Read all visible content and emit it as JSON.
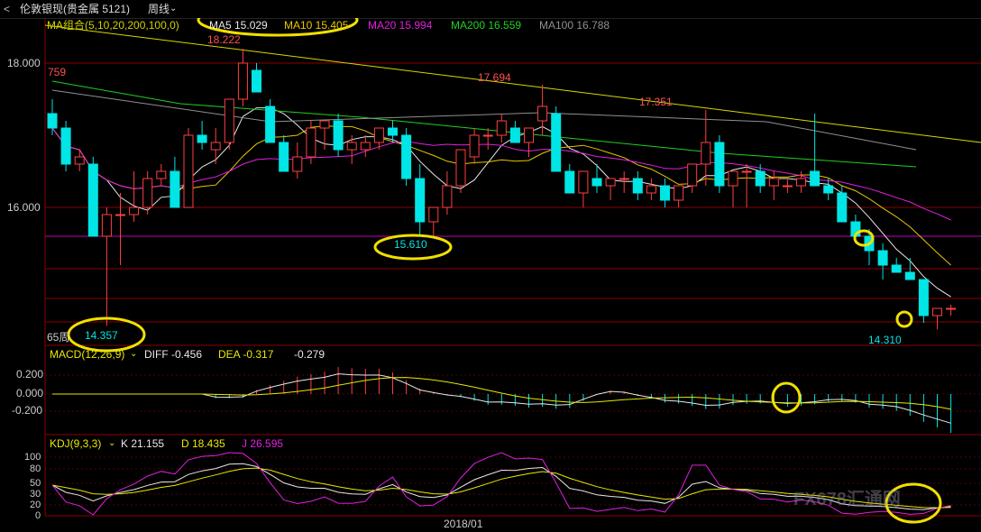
{
  "window": {
    "title": "伦敦银现(贵金属 5121)",
    "period": "周线",
    "back_label": "<"
  },
  "main_panel": {
    "indicator_label": "MA组合(5,10,20,200,100,0)",
    "ma": [
      {
        "label": "MA5 15.029",
        "color": "#e8e800"
      },
      {
        "label": "MA10 15.405",
        "color": "#e8c800"
      },
      {
        "label": "MA20 15.994",
        "color": "#e020e0"
      },
      {
        "label": "MA200 16.559",
        "color": "#20d020"
      },
      {
        "label": "MA100 16.788",
        "color": "#909090"
      }
    ],
    "price_ticks": [
      "18.000",
      "16.000"
    ],
    "annotations": {
      "high_top": "18.222",
      "left_edge": "759",
      "peak_mid": "17.694",
      "peak_right": "17.351",
      "low_left": "14.357",
      "low_mid": "15.610",
      "low_right": "14.310",
      "bottom_left": "65周"
    }
  },
  "macd_panel": {
    "label": "MACD(12,26,9)",
    "diff": "DIFF -0.456",
    "dea": "DEA -0.317",
    "macd": "-0.279",
    "ticks": [
      "0.200",
      "0.000",
      "-0.200"
    ]
  },
  "kdj_panel": {
    "label": "KDJ(9,3,3)",
    "k": "K 21.155",
    "d": "D 18.435",
    "j": "J 26.595",
    "ticks": [
      "100",
      "80",
      "50",
      "30",
      "20",
      "0"
    ]
  },
  "x_axis": {
    "date_label": "2018/01"
  },
  "watermark": "FX678汇通网",
  "colors": {
    "up": "#ff4040",
    "down": "#00e5e5",
    "grid": "#8b0000",
    "highlight": "#f0e000"
  },
  "chart_data": {
    "type": "candlestick",
    "note": "weekly OHLC, approximate",
    "candles": [
      [
        17.3,
        17.5,
        17.0,
        17.1
      ],
      [
        17.1,
        17.2,
        16.5,
        16.6
      ],
      [
        16.6,
        16.8,
        16.5,
        16.7
      ],
      [
        16.6,
        16.7,
        15.6,
        15.6
      ],
      [
        15.6,
        16.0,
        14.36,
        15.9
      ],
      [
        15.9,
        16.2,
        15.2,
        15.9
      ],
      [
        15.9,
        16.5,
        15.8,
        16.0
      ],
      [
        16.0,
        16.5,
        15.9,
        16.4
      ],
      [
        16.4,
        16.6,
        16.3,
        16.5
      ],
      [
        16.5,
        16.7,
        16.1,
        16.0
      ],
      [
        16.0,
        17.1,
        16.0,
        17.0
      ],
      [
        17.0,
        17.2,
        16.8,
        16.9
      ],
      [
        16.8,
        17.1,
        16.6,
        16.9
      ],
      [
        16.9,
        17.4,
        16.8,
        17.5
      ],
      [
        17.5,
        18.2,
        17.4,
        18.0
      ],
      [
        17.9,
        18.0,
        17.6,
        17.6
      ],
      [
        17.4,
        17.5,
        17.0,
        16.9
      ],
      [
        16.9,
        17.0,
        16.5,
        16.5
      ],
      [
        16.5,
        16.9,
        16.4,
        16.7
      ],
      [
        16.7,
        17.2,
        16.6,
        17.1
      ],
      [
        17.1,
        17.2,
        16.8,
        17.2
      ],
      [
        17.2,
        17.3,
        16.7,
        16.8
      ],
      [
        16.8,
        17.0,
        16.6,
        16.9
      ],
      [
        16.8,
        17.0,
        16.7,
        16.9
      ],
      [
        16.9,
        17.1,
        16.8,
        17.1
      ],
      [
        17.1,
        17.2,
        16.9,
        17.0
      ],
      [
        17.0,
        17.1,
        16.3,
        16.4
      ],
      [
        16.4,
        16.6,
        15.6,
        15.8
      ],
      [
        15.8,
        16.0,
        15.6,
        16.0
      ],
      [
        16.0,
        16.5,
        15.9,
        16.3
      ],
      [
        16.3,
        16.8,
        16.2,
        16.8
      ],
      [
        16.7,
        17.1,
        16.6,
        17.0
      ],
      [
        17.0,
        17.1,
        16.8,
        17.0
      ],
      [
        17.0,
        17.3,
        16.9,
        17.2
      ],
      [
        17.1,
        17.2,
        16.9,
        16.9
      ],
      [
        16.9,
        17.1,
        16.7,
        17.1
      ],
      [
        17.2,
        17.7,
        17.0,
        17.4
      ],
      [
        17.3,
        17.4,
        16.5,
        16.5
      ],
      [
        16.5,
        16.6,
        16.2,
        16.2
      ],
      [
        16.2,
        16.5,
        16.0,
        16.5
      ],
      [
        16.4,
        16.6,
        16.2,
        16.3
      ],
      [
        16.3,
        16.4,
        16.1,
        16.4
      ],
      [
        16.4,
        16.5,
        16.2,
        16.4
      ],
      [
        16.4,
        16.5,
        16.1,
        16.2
      ],
      [
        16.2,
        16.4,
        16.1,
        16.3
      ],
      [
        16.3,
        16.4,
        16.0,
        16.1
      ],
      [
        16.1,
        16.3,
        16.0,
        16.3
      ],
      [
        16.3,
        16.6,
        16.2,
        16.6
      ],
      [
        16.6,
        17.35,
        16.3,
        16.9
      ],
      [
        16.9,
        17.0,
        16.2,
        16.3
      ],
      [
        16.3,
        16.4,
        16.0,
        16.5
      ],
      [
        16.5,
        16.6,
        16.0,
        16.5
      ],
      [
        16.5,
        16.6,
        16.2,
        16.3
      ],
      [
        16.3,
        16.5,
        16.1,
        16.4
      ],
      [
        16.3,
        16.4,
        16.2,
        16.3
      ],
      [
        16.3,
        16.5,
        16.2,
        16.4
      ],
      [
        16.5,
        17.3,
        16.3,
        16.3
      ],
      [
        16.3,
        16.4,
        16.1,
        16.2
      ],
      [
        16.2,
        16.3,
        15.8,
        15.8
      ],
      [
        15.8,
        15.9,
        15.5,
        15.6
      ],
      [
        15.6,
        15.7,
        15.2,
        15.4
      ],
      [
        15.4,
        15.5,
        15.0,
        15.2
      ],
      [
        15.2,
        15.3,
        15.1,
        15.1
      ],
      [
        15.1,
        15.3,
        15.0,
        15.0
      ],
      [
        15.0,
        15.0,
        14.4,
        14.5
      ],
      [
        14.5,
        14.6,
        14.31,
        14.6
      ],
      [
        14.6,
        14.65,
        14.5,
        14.6
      ]
    ]
  }
}
